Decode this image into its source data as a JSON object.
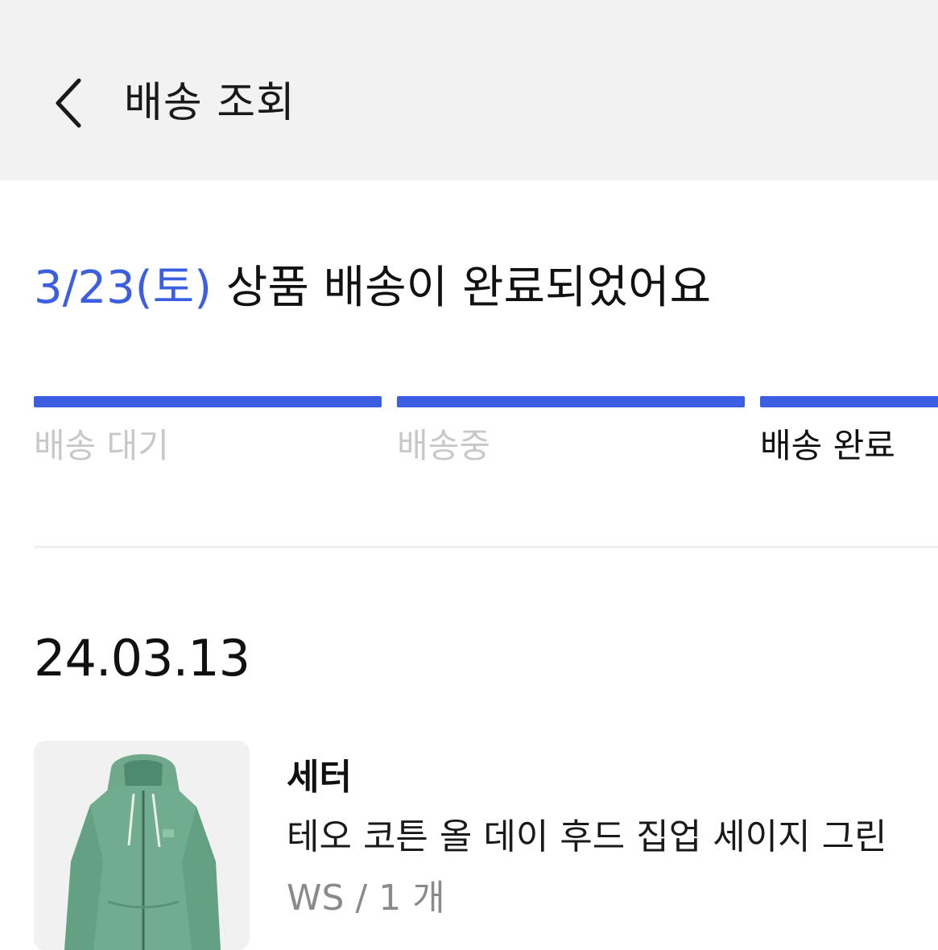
{
  "header": {
    "title": "배송 조회",
    "back_icon": "chevron-left-icon",
    "background": "#f2f2f2"
  },
  "status": {
    "date": "3/23(토)",
    "message": "상품 배송이 완료되었어요",
    "accent_color": "#3b5fe0"
  },
  "progress": {
    "completed_steps": 3,
    "total_steps": 3,
    "steps": [
      {
        "label": "배송 대기",
        "state": "done"
      },
      {
        "label": "배송중",
        "state": "done"
      },
      {
        "label": "배송 완료",
        "state": "current"
      }
    ]
  },
  "order": {
    "date": "24.03.13",
    "item": {
      "brand": "세터",
      "name": "테오 코튼 올 데이 후드 집업 세이지 그린",
      "option": "WS / 1 개",
      "image": "green-hoodie-image"
    }
  }
}
